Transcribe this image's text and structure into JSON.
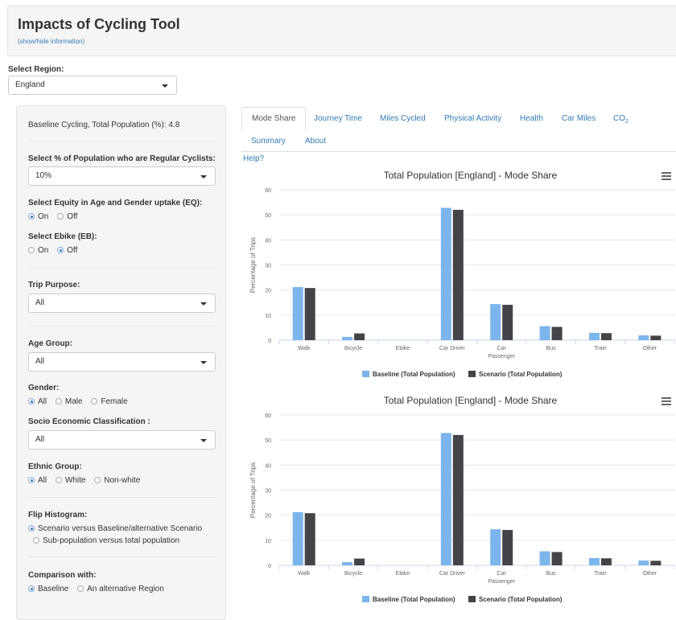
{
  "header": {
    "title": "Impacts of Cycling Tool",
    "info_link": "(show/hide information)"
  },
  "region": {
    "label": "Select Region:",
    "value": "England"
  },
  "sidebar": {
    "baseline_text": "Baseline Cycling, Total Population (%): 4.8",
    "regular_cyclists": {
      "label": "Select % of Population who are Regular Cyclists:",
      "value": "10%"
    },
    "equity": {
      "label": "Select Equity in Age and Gender uptake (EQ):",
      "options": [
        "On",
        "Off"
      ],
      "selected": "On"
    },
    "ebike": {
      "label": "Select Ebike (EB):",
      "options": [
        "On",
        "Off"
      ],
      "selected": "Off"
    },
    "trip_purpose": {
      "label": "Trip Purpose:",
      "value": "All"
    },
    "age_group": {
      "label": "Age Group:",
      "value": "All"
    },
    "gender": {
      "label": "Gender:",
      "options": [
        "All",
        "Male",
        "Female"
      ],
      "selected": "All"
    },
    "ses": {
      "label": "Socio Economic Classification :",
      "value": "All"
    },
    "ethnic": {
      "label": "Ethnic Group:",
      "options": [
        "All",
        "White",
        "Non-white"
      ],
      "selected": "All"
    },
    "flip": {
      "label": "Flip Histogram:",
      "options": [
        "Scenario versus Baseline/alternative Scenario",
        "Sub-population versus total population"
      ],
      "selected": "Scenario versus Baseline/alternative Scenario"
    },
    "comparison": {
      "label": "Comparison with:",
      "options": [
        "Baseline",
        "An alternative Region"
      ],
      "selected": "Baseline"
    }
  },
  "tabs": {
    "row1": [
      "Mode Share",
      "Journey Time",
      "Miles Cycled",
      "Physical Activity",
      "Health",
      "Car Miles",
      "CO"
    ],
    "co2_sub": "2",
    "row2": [
      "Summary",
      "About"
    ],
    "active": "Mode Share"
  },
  "help_link": "Help?",
  "colors": {
    "baseline": "#7cb5ec",
    "scenario": "#434348",
    "link": "#337ab7"
  },
  "chart_data": [
    {
      "type": "bar",
      "title": "Total Population [England] - Mode Share",
      "ylabel": "Percentage of Trips",
      "xlabel": "",
      "ylim": [
        0,
        60
      ],
      "yticks": [
        0,
        10,
        20,
        30,
        40,
        50,
        60
      ],
      "categories": [
        "Walk",
        "Bicycle",
        "Ebike",
        "Car Driver",
        "Car Passenger",
        "Bus",
        "Train",
        "Other"
      ],
      "category_lines": [
        [
          "Walk"
        ],
        [
          "Bicycle"
        ],
        [
          "Ebike"
        ],
        [
          "Car Driver"
        ],
        [
          "Car",
          "Passenger"
        ],
        [
          "Bus"
        ],
        [
          "Train"
        ],
        [
          "Other"
        ]
      ],
      "series": [
        {
          "name": "Baseline (Total Population)",
          "values": [
            21.2,
            1.3,
            0,
            52.8,
            14.4,
            5.6,
            2.9,
            1.9
          ]
        },
        {
          "name": "Scenario (Total Population)",
          "values": [
            20.8,
            2.7,
            0,
            52.0,
            14.1,
            5.3,
            2.8,
            1.8
          ]
        }
      ],
      "legend": "bottom-center",
      "grid": true
    },
    {
      "type": "bar",
      "title": "Total Population [England] - Mode Share",
      "ylabel": "Percentage of Trips",
      "xlabel": "",
      "ylim": [
        0,
        60
      ],
      "yticks": [
        0,
        10,
        20,
        30,
        40,
        50,
        60
      ],
      "categories": [
        "Walk",
        "Bicycle",
        "Ebike",
        "Car Driver",
        "Car Passenger",
        "Bus",
        "Train",
        "Other"
      ],
      "category_lines": [
        [
          "Walk"
        ],
        [
          "Bicycle"
        ],
        [
          "Ebike"
        ],
        [
          "Car Driver"
        ],
        [
          "Car",
          "Passenger"
        ],
        [
          "Bus"
        ],
        [
          "Train"
        ],
        [
          "Other"
        ]
      ],
      "series": [
        {
          "name": "Baseline (Total Population)",
          "values": [
            21.2,
            1.3,
            0,
            52.8,
            14.4,
            5.6,
            2.9,
            1.9
          ]
        },
        {
          "name": "Scenario (Total Population)",
          "values": [
            20.8,
            2.7,
            0,
            52.0,
            14.1,
            5.3,
            2.8,
            1.8
          ]
        }
      ],
      "legend": "bottom-center",
      "grid": true
    }
  ]
}
